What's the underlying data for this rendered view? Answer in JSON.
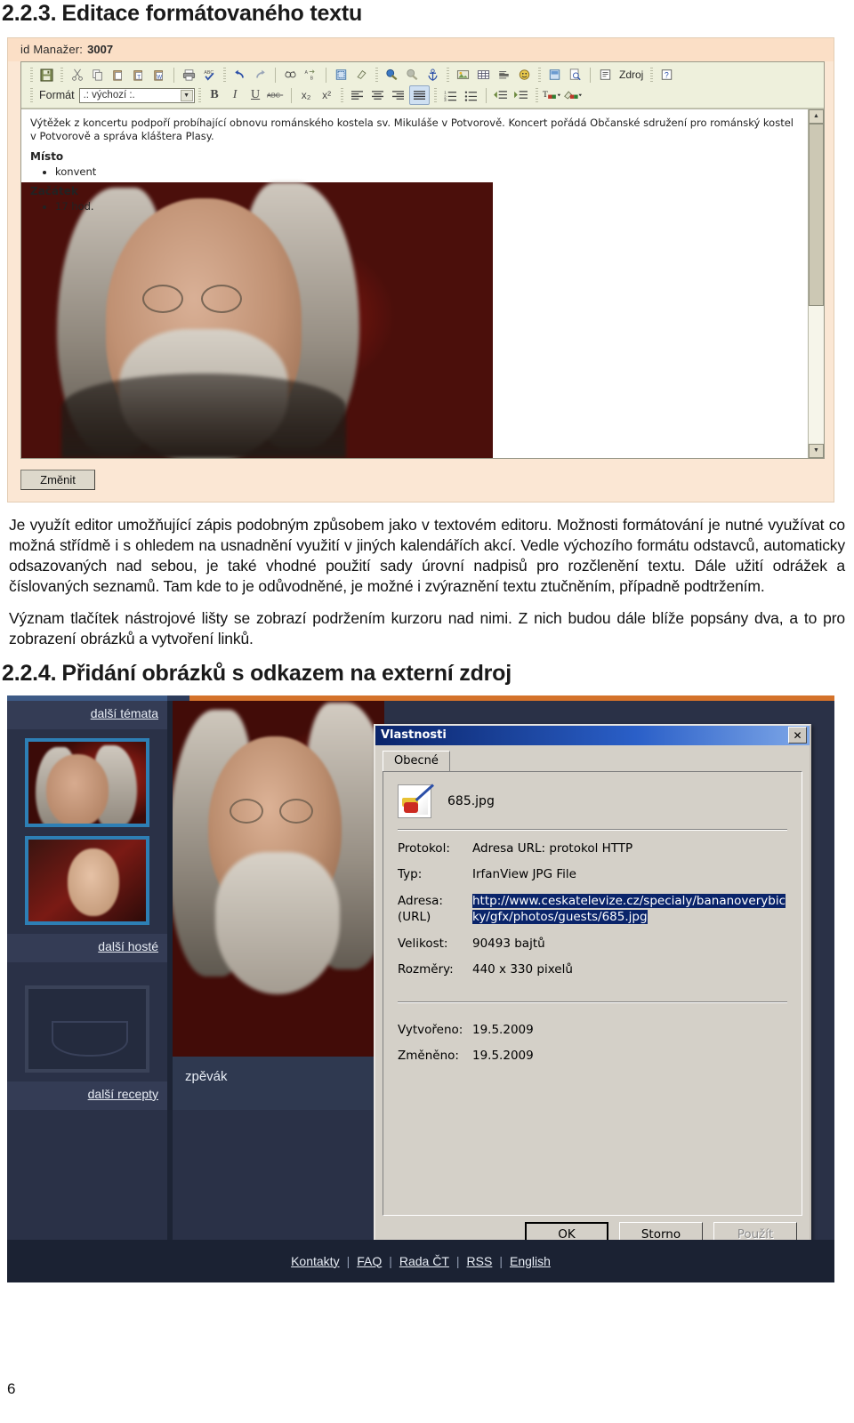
{
  "section1": {
    "number": "2.2.3.",
    "title": "Editace formátovaného textu"
  },
  "section2": {
    "number": "2.2.4.",
    "title": "Přidání obrázků s odkazem na externí zdroj"
  },
  "editor_screenshot": {
    "window_label": "id Manažer:",
    "window_id": "3007",
    "toolbar": {
      "format_label": "Formát",
      "format_value": ".: výchozí :.",
      "source_button": "Zdroj",
      "buttons_row1": [
        "save-icon",
        "cut-icon",
        "copy-icon",
        "paste-icon",
        "paste-text-icon",
        "paste-word-icon",
        "print-icon",
        "spellcheck-icon",
        "undo-icon",
        "redo-icon",
        "find-icon",
        "replace-icon",
        "select-all-icon",
        "remove-format-icon",
        "link-icon",
        "unlink-icon",
        "anchor-icon",
        "image-icon",
        "table-icon",
        "horizontal-rule-icon",
        "smiley-icon",
        "page-break-icon",
        "preview-icon",
        "source-icon",
        "help-icon"
      ],
      "buttons_row2": [
        "bold-icon",
        "italic-icon",
        "underline-icon",
        "strike-icon",
        "subscript-icon",
        "superscript-icon",
        "align-left-icon",
        "align-center-icon",
        "align-right-icon",
        "justify-icon",
        "numbered-list-icon",
        "bullet-list-icon",
        "outdent-icon",
        "indent-icon",
        "text-color-icon",
        "background-color-icon"
      ],
      "bold": "B",
      "italic": "I",
      "underline": "U",
      "strike": "ABC",
      "subscript": "x₂",
      "superscript": "x²"
    },
    "content": {
      "paragraph": "Výtěžek z koncertu podpoří probíhající obnovu románského kostela sv. Mikuláše v Potvorově. Koncert pořádá Občanské sdružení pro románský kostel v Potvorově a správa kláštera Plasy.",
      "heading1": "Místo",
      "item1": "konvent",
      "heading2": "Začátek",
      "item2": "17 hod."
    },
    "submit_button": "Změnit"
  },
  "body_paragraphs": [
    "Je využít editor umožňující zápis podobným způsobem jako v textovém editoru. Možnosti formátování je nutné využívat co možná střídmě i s ohledem na usnadnění využití v jiných kalendářích akcí. Vedle výchozího formátu odstavců, automaticky odsazovaných nad sebou, je také vhodné použití sady úrovní nadpisů pro rozčlenění textu. Dále užití odrážek a číslovaných seznamů. Tam kde to je odůvodněné, je možné i zvýraznění textu ztučněním, případně podtržením.",
    "Význam tlačítek nástrojové lišty se zobrazí podržením kurzoru nad nimi. Z nich budou dále blíže popsány dva, a to pro zobrazení obrázků a vytvoření linků."
  ],
  "web_screenshot": {
    "sidebar": {
      "link_topics": "další témata",
      "link_guests": "další hosté",
      "link_recipes": "další recepty"
    },
    "caption": "zpěvák",
    "footer_links": [
      "Kontakty",
      "FAQ",
      "Rada ČT",
      "RSS",
      "English"
    ],
    "footer_separator": "|"
  },
  "dialog": {
    "title": "Vlastnosti",
    "close_label": "✕",
    "tab": "Obecné",
    "file_name": "685.jpg",
    "fields": [
      {
        "key": "Protokol:",
        "value": "Adresa URL: protokol HTTP",
        "selected": false
      },
      {
        "key": "Typ:",
        "value": "IrfanView JPG File",
        "selected": false
      },
      {
        "key": "Adresa:\n(URL)",
        "value": "http://www.ceskatelevize.cz/specialy/bananoverybicky/gfx/photos/guests/685.jpg",
        "selected": true
      },
      {
        "key": "Velikost:",
        "value": "90493 bajtů",
        "selected": false
      },
      {
        "key": "Rozměry:",
        "value": "440 x 330 pixelů",
        "selected": false
      },
      {
        "key": "Vytvořeno:",
        "value": "19.5.2009",
        "selected": false
      },
      {
        "key": "Změněno:",
        "value": "19.5.2009",
        "selected": false
      }
    ],
    "field_keys": {
      "protokol": "Protokol:",
      "typ": "Typ:",
      "adresa_line1": "Adresa:",
      "adresa_line2": "(URL)",
      "velikost": "Velikost:",
      "rozmery": "Rozměry:",
      "vytvoreno": "Vytvořeno:",
      "zmeneno": "Změněno:"
    },
    "field_values": {
      "protokol": "Adresa URL: protokol HTTP",
      "typ": "IrfanView JPG File",
      "adresa": "http://www.ceskatelevize.cz/specialy/bananoverybicky/gfx/photos/guests/685.jpg",
      "velikost": "90493 bajtů",
      "rozmery": "440 x 330 pixelů",
      "vytvoreno": "19.5.2009",
      "zmeneno": "19.5.2009"
    },
    "buttons": {
      "ok": "OK",
      "cancel": "Storno",
      "apply": "Použít"
    }
  },
  "page_number": "6",
  "colors": {
    "accent_orange": "#d4722a",
    "dialog_title": "#0a246a",
    "selection": "#0a246a",
    "web_bg": "#2a3147"
  }
}
